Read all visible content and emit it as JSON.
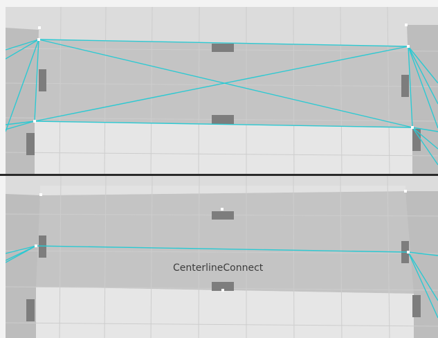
{
  "scene": {
    "background_color": "#e1e1e1",
    "road_color": "#c8c8c8",
    "gap_color": "#dedede",
    "grid_color": "#cfcfcf",
    "connector_color": "#2cc9d2",
    "marker_color": "#ffffff",
    "block_color": "#7d7d7d"
  },
  "views": {
    "top": {
      "label": ""
    },
    "bottom": {
      "label": "CenterlineConnect"
    }
  }
}
